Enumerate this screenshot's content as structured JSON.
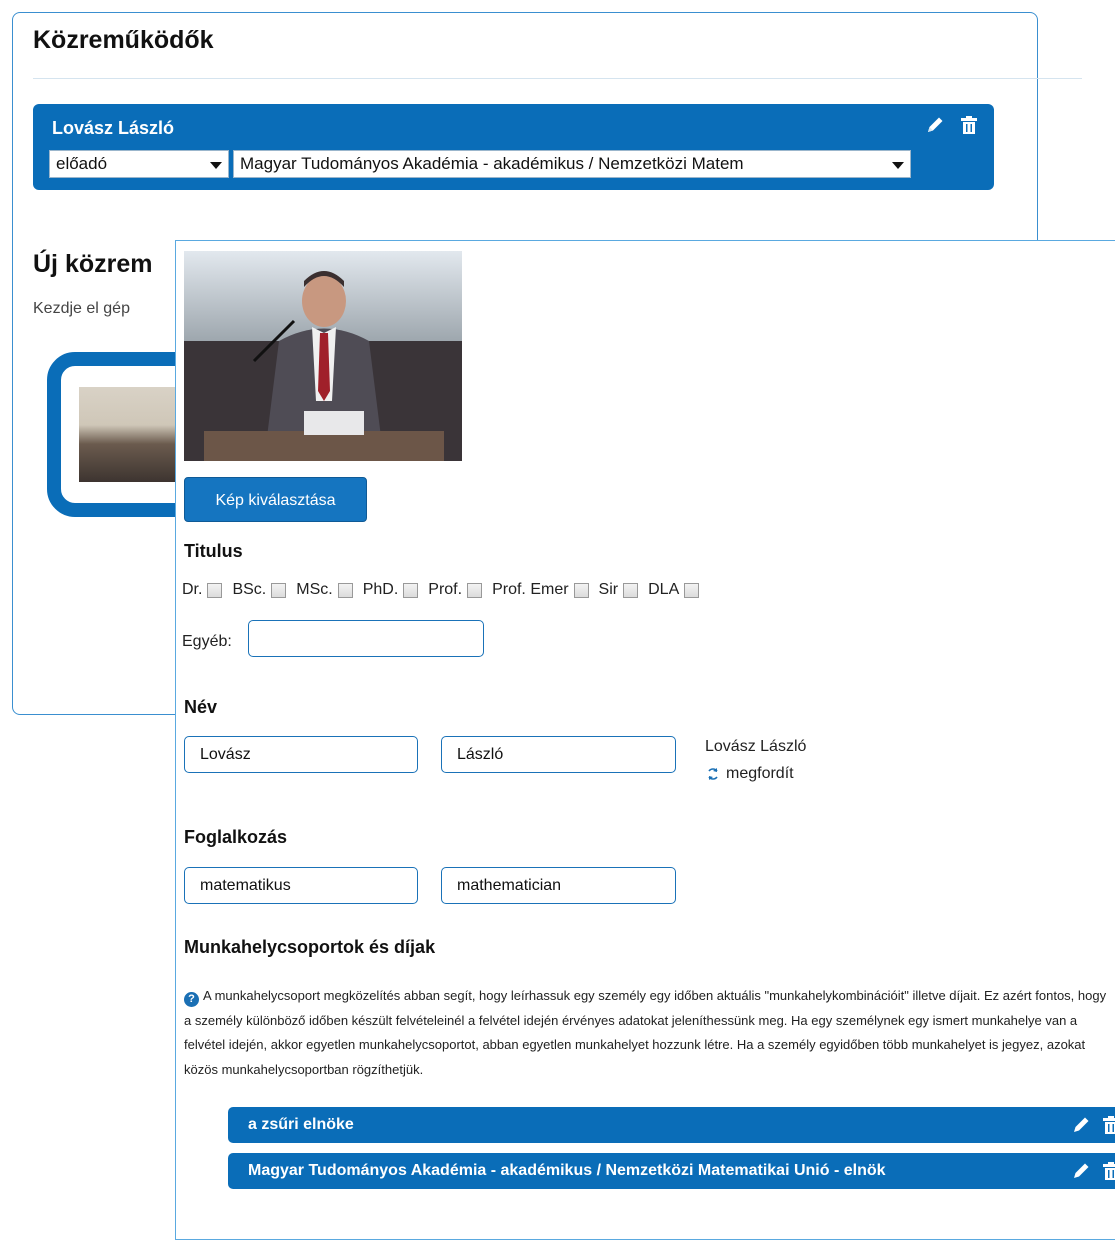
{
  "background": {
    "title": "Közreműködők",
    "contributor": {
      "name": "Lovász László",
      "role": "előadó",
      "affiliation": "Magyar Tudományos Akadémia - akadémikus / Nemzetközi Matem"
    },
    "new_title": "Új közrem",
    "new_hint": "Kezdje el gép"
  },
  "editor": {
    "photo_button": "Kép kiválasztása",
    "titles_heading": "Titulus",
    "titles": [
      "Dr.",
      "BSc.",
      "MSc.",
      "PhD.",
      "Prof.",
      "Prof. Emer",
      "Sir",
      "DLA"
    ],
    "other_label": "Egyéb:",
    "other_value": "",
    "name_heading": "Név",
    "last_name": "Lovász",
    "first_name": "László",
    "name_preview": "Lovász László",
    "flip_label": "megfordít",
    "occupation_heading": "Foglalkozás",
    "occupation_hu": "matematikus",
    "occupation_en": "mathematician",
    "workgroups_heading": "Munkahelycsoportok és díjak",
    "workgroups_info": "A munkahelycsoport megközelítés abban segít, hogy leírhassuk egy személy egy időben aktuális \"munkahelykombinációit\" illetve díjait. Ez azért fontos, hogy a személy különböző időben készült felvételeinél a felvétel idején érvényes adatokat jeleníthessünk meg. Ha egy személynek egy ismert munkahelye van a felvétel idején, akkor egyetlen munkahelycsoportot, abban egyetlen munkahelyet hozzunk létre. Ha a személy egyidőben több munkahelyet is jegyez, azokat közös munkahelycsoportban rögzíthetjük.",
    "workgroups": [
      "a zsűri elnöke",
      "Magyar Tudományos Akadémia - akadémikus / Nemzetközi Matematikai Unió - elnök"
    ]
  },
  "colors": {
    "accent": "#0a6db8",
    "border": "#1a72b8"
  }
}
